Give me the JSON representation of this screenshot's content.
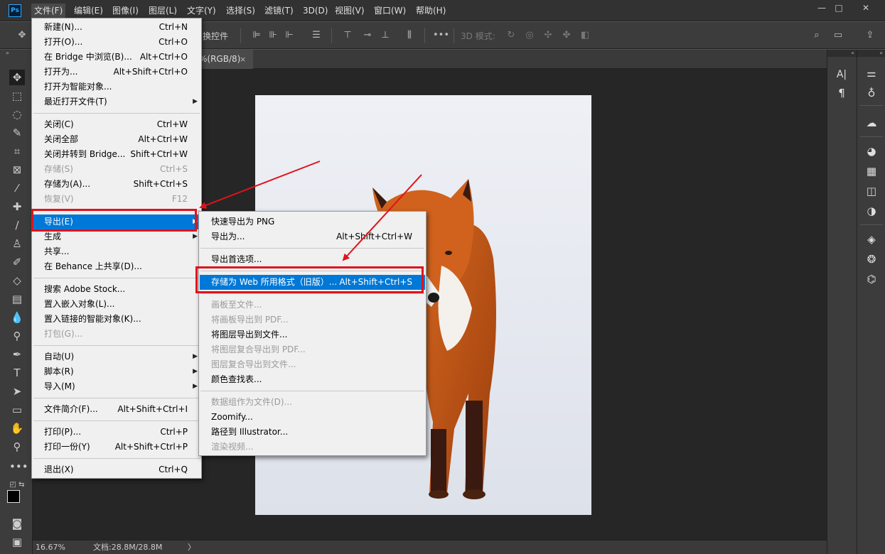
{
  "menubar": {
    "items": [
      "文件(F)",
      "编辑(E)",
      "图像(I)",
      "图层(L)",
      "文字(Y)",
      "选择(S)",
      "滤镜(T)",
      "3D(D)",
      "视图(V)",
      "窗口(W)",
      "帮助(H)"
    ],
    "window_controls": {
      "minimize": "—",
      "maximize": "□",
      "close": "✕"
    }
  },
  "optbar": {
    "transform_label": "换控件",
    "mode_3d_label": "3D 模式:"
  },
  "document": {
    "tab_label": "%(RGB/8)",
    "tab_close": "×"
  },
  "status": {
    "zoom": "16.67%",
    "doc_info": "文档:28.8M/28.8M",
    "arrow": "〉"
  },
  "file_menu": {
    "items": [
      {
        "label": "新建(N)...",
        "shortcut": "Ctrl+N"
      },
      {
        "label": "打开(O)...",
        "shortcut": "Ctrl+O"
      },
      {
        "label": "在 Bridge 中浏览(B)...",
        "shortcut": "Alt+Ctrl+O"
      },
      {
        "label": "打开为...",
        "shortcut": "Alt+Shift+Ctrl+O"
      },
      {
        "label": "打开为智能对象...",
        "shortcut": ""
      },
      {
        "label": "最近打开文件(T)",
        "shortcut": ""
      },
      {
        "label": "关闭(C)",
        "shortcut": "Ctrl+W"
      },
      {
        "label": "关闭全部",
        "shortcut": "Alt+Ctrl+W"
      },
      {
        "label": "关闭并转到 Bridge...",
        "shortcut": "Shift+Ctrl+W"
      },
      {
        "label": "存储(S)",
        "shortcut": "Ctrl+S"
      },
      {
        "label": "存储为(A)...",
        "shortcut": "Shift+Ctrl+S"
      },
      {
        "label": "恢复(V)",
        "shortcut": "F12"
      },
      {
        "label": "导出(E)",
        "shortcut": ""
      },
      {
        "label": "生成",
        "shortcut": ""
      },
      {
        "label": "共享...",
        "shortcut": ""
      },
      {
        "label": "在 Behance 上共享(D)...",
        "shortcut": ""
      },
      {
        "label": "搜索 Adobe Stock...",
        "shortcut": ""
      },
      {
        "label": "置入嵌入对象(L)...",
        "shortcut": ""
      },
      {
        "label": "置入链接的智能对象(K)...",
        "shortcut": ""
      },
      {
        "label": "打包(G)...",
        "shortcut": ""
      },
      {
        "label": "自动(U)",
        "shortcut": ""
      },
      {
        "label": "脚本(R)",
        "shortcut": ""
      },
      {
        "label": "导入(M)",
        "shortcut": ""
      },
      {
        "label": "文件简介(F)...",
        "shortcut": "Alt+Shift+Ctrl+I"
      },
      {
        "label": "打印(P)...",
        "shortcut": "Ctrl+P"
      },
      {
        "label": "打印一份(Y)",
        "shortcut": "Alt+Shift+Ctrl+P"
      },
      {
        "label": "退出(X)",
        "shortcut": "Ctrl+Q"
      }
    ]
  },
  "export_menu": {
    "items": [
      {
        "label": "快速导出为 PNG",
        "shortcut": ""
      },
      {
        "label": "导出为...",
        "shortcut": "Alt+Shift+Ctrl+W"
      },
      {
        "label": "导出首选项...",
        "shortcut": ""
      },
      {
        "label": "存储为 Web 所用格式（旧版）...",
        "shortcut": "Alt+Shift+Ctrl+S"
      },
      {
        "label": "画板至文件...",
        "shortcut": ""
      },
      {
        "label": "将画板导出到 PDF...",
        "shortcut": ""
      },
      {
        "label": "将图层导出到文件...",
        "shortcut": ""
      },
      {
        "label": "将图层复合导出到 PDF...",
        "shortcut": ""
      },
      {
        "label": "图层复合导出到文件...",
        "shortcut": ""
      },
      {
        "label": "颜色查找表...",
        "shortcut": ""
      },
      {
        "label": "数据组作为文件(D)...",
        "shortcut": ""
      },
      {
        "label": "Zoomify...",
        "shortcut": ""
      },
      {
        "label": "路径到 Illustrator...",
        "shortcut": ""
      },
      {
        "label": "渲染视频...",
        "shortcut": ""
      }
    ]
  },
  "right_panel": {
    "char_icon": "A|",
    "para_icon": "¶"
  },
  "colors": {
    "highlight": "#0078d7",
    "annotation_red": "#e0131c"
  }
}
